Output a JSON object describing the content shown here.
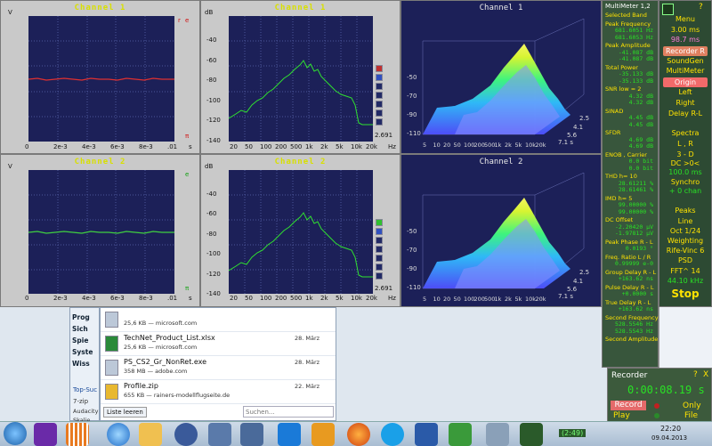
{
  "channels": {
    "time1": {
      "title": "Channel 1",
      "y_unit": "V",
      "x_unit": "s",
      "x_ticks": [
        "0",
        "2e-3",
        "4e-3",
        "6e-3",
        "8e-3",
        ".01"
      ],
      "marker_e": "e",
      "marker_pi": "π",
      "marker_r": "r"
    },
    "time2": {
      "title": "Channel 2",
      "y_unit": "V",
      "x_unit": "s",
      "x_ticks": [
        "0",
        "2e-3",
        "4e-3",
        "6e-3",
        "8e-3",
        ".01"
      ],
      "marker_e": "e",
      "marker_pi": "π",
      "marker_r": "r"
    },
    "spec1": {
      "title": "Channel 1",
      "y_unit": "dB",
      "x_unit": "Hz",
      "y_ticks": [
        "-40",
        "-60",
        "-80",
        "-100",
        "-120",
        "-140"
      ],
      "x_ticks": [
        "20",
        "50",
        "100",
        "200",
        "500",
        "1k",
        "2k",
        "5k",
        "10k",
        "20k"
      ],
      "corner": "2.691"
    },
    "spec2": {
      "title": "Channel 2",
      "y_unit": "dB",
      "x_unit": "Hz",
      "y_ticks": [
        "-40",
        "-60",
        "-80",
        "-100",
        "-120",
        "-140"
      ],
      "x_ticks": [
        "20",
        "50",
        "100",
        "200",
        "500",
        "1k",
        "2k",
        "5k",
        "10k",
        "20k"
      ],
      "corner": "2.691"
    },
    "wf1": {
      "title": "Channel 1",
      "y_ticks": [
        "-50",
        "-70",
        "-90",
        "-110"
      ],
      "x_ticks": [
        "5",
        "10",
        "20",
        "50",
        "100",
        "200",
        "500",
        "1k",
        "2k",
        "5k",
        "10k",
        "20k"
      ],
      "depth_ticks": [
        "2.5",
        "4.1",
        "5.6",
        "7.1 s"
      ]
    },
    "wf2": {
      "title": "Channel 2",
      "y_ticks": [
        "-50",
        "-70",
        "-90",
        "-110"
      ],
      "x_ticks": [
        "5",
        "10",
        "20",
        "50",
        "100",
        "200",
        "500",
        "1k",
        "2k",
        "5k",
        "10k",
        "20k"
      ],
      "depth_ticks": [
        "2.5",
        "4.1",
        "5.6",
        "7.1 s"
      ]
    }
  },
  "multimeter": {
    "title": "MultiMeter 1,2",
    "rows": [
      {
        "label": "Selected Band",
        "v1": "",
        "v2": ""
      },
      {
        "label": "Peak Frequency",
        "v1": "681.6051 Hz",
        "v2": "681.6053 Hz"
      },
      {
        "label": "Peak Amplitude",
        "v1": "-41.087 dB",
        "v2": "-41.087 dB"
      },
      {
        "label": "Total Power",
        "v1": "-35.133 dB",
        "v2": "-35.133 dB"
      },
      {
        "label": "SNR   low = 2",
        "v1": "4.32 dB",
        "v2": "4.32 dB"
      },
      {
        "label": "SINAD",
        "v1": "4.45 dB",
        "v2": "4.45 dB"
      },
      {
        "label": "SFDR",
        "v1": "4.69 dB",
        "v2": "4.69 dB"
      },
      {
        "label": "ENOB , Carrier",
        "v1": "0.0 bit",
        "v2": "0.0 bit"
      },
      {
        "label": "THD      h= 10",
        "v1": "28.61211 %",
        "v2": "28.61461 %"
      },
      {
        "label": "IMD      h= 5",
        "v1": "99.00000 %",
        "v2": "99.00000 %"
      },
      {
        "label": "DC Offset",
        "v1": "-2.20420 μV",
        "v2": "-1.97812 μV"
      },
      {
        "label": "Peak Phase R - L",
        "v1": "0.0193 °",
        "v2": ""
      },
      {
        "label": "Freq. Ratio  L / R",
        "v1": "0.99999 e-0",
        "v2": ""
      },
      {
        "label": "Group Delay R - L",
        "v1": "+163.62 ns",
        "v2": ""
      },
      {
        "label": "Pulse Delay R - L",
        "v1": "+0.0000 s",
        "v2": ""
      },
      {
        "label": "True  Delay R - L",
        "v1": "+163.62 ns",
        "v2": ""
      },
      {
        "label": "Second Frequency",
        "v1": "528.5546 Hz",
        "v2": "528.5543 Hz"
      },
      {
        "label": "Second Amplitude",
        "v1": "",
        "v2": ""
      }
    ]
  },
  "menu": {
    "title": "Menu",
    "help": "?",
    "time1": "3.00 ms",
    "time2": "98.7 ms",
    "recorder_btn": "Recorder R",
    "soundgen": "SoundGen",
    "multimeter": "MultiMeter",
    "origin": "Origin",
    "left": "Left",
    "right": "Right",
    "delay": "Delay R-L",
    "spectra": "Spectra",
    "lr": "L , R",
    "threed": "3 - D",
    "dc": "DC  >0<",
    "dc_val": "100.0 ms",
    "synchro": "Synchro",
    "synchro_val": "+ 0 chan",
    "peaks": "Peaks",
    "line": "Line",
    "oct": "Oct  1/24",
    "weighting": "Weighting",
    "rife": "Rife-Vinc 6",
    "psd": "PSD",
    "fft": "FFT^ 14",
    "rate": "44.10 kHz",
    "stop": "Stop"
  },
  "recorder": {
    "title": "Recorder",
    "help": "?",
    "close": "X",
    "timer": "0:00:08.19 s",
    "record": "Record",
    "play": "Play",
    "only": "Only",
    "file": "File"
  },
  "downloads": {
    "items": [
      {
        "name": "",
        "size": "25,6 KB — microsoft.com",
        "date": ""
      },
      {
        "name": "TechNet_Product_List.xlsx",
        "size": "25,6 KB — microsoft.com",
        "date": "28. März"
      },
      {
        "name": "PS_CS2_Gr_NonRet.exe",
        "size": "358 MB — adobe.com",
        "date": "28. März"
      },
      {
        "name": "Profile.zip",
        "size": "655 KB — rainers-modellflugseite.de",
        "date": "22. März"
      }
    ],
    "clear": "Liste leeren",
    "search_placeholder": "Suchen..."
  },
  "side_list": [
    "Prog",
    "Sich",
    "Spie",
    "Syste",
    "Wiss"
  ],
  "side_text": {
    "top": "Top-Suc",
    "zip": "7-zip",
    "audacity": "Audacity",
    "last": "Skalie"
  },
  "taskbar": {
    "clock": "22:20",
    "date": "09.04.2013",
    "sound_badge": "(2:49)"
  }
}
